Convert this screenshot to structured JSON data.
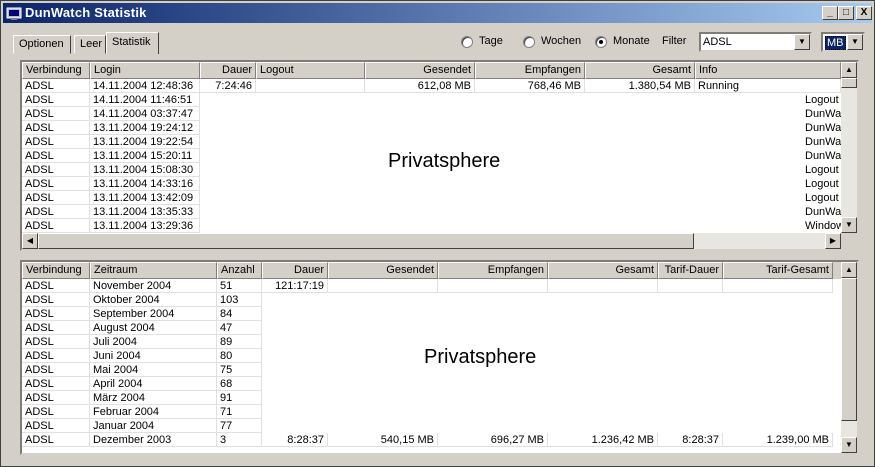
{
  "window": {
    "title": "DunWatch Statistik",
    "min": "_",
    "max": "□",
    "close": "X"
  },
  "tabs": [
    {
      "label": "Optionen"
    },
    {
      "label": "Leer"
    },
    {
      "label": "Statistik"
    }
  ],
  "radios": [
    {
      "label": "Tage",
      "checked": false
    },
    {
      "label": "Wochen",
      "checked": false
    },
    {
      "label": "Monate",
      "checked": true
    }
  ],
  "filter": {
    "label": "Filter",
    "value": "ADSL"
  },
  "unit": {
    "value": "MB"
  },
  "top_table": {
    "columns": [
      "Verbindung",
      "Login",
      "Dauer",
      "Logout",
      "Gesendet",
      "Empfangen",
      "Gesamt",
      "Info"
    ],
    "rows": [
      [
        "ADSL",
        "14.11.2004 12:48:36",
        "7:24:46",
        "",
        "612,08 MB",
        "768,46 MB",
        "1.380,54 MB",
        "Running"
      ],
      [
        "ADSL",
        "14.11.2004 11:46:51",
        "",
        "",
        "",
        "",
        "",
        "Logout"
      ],
      [
        "ADSL",
        "14.11.2004 03:37:47",
        "",
        "",
        "",
        "",
        "",
        "DunWa"
      ],
      [
        "ADSL",
        "13.11.2004 19:24:12",
        "",
        "",
        "",
        "",
        "",
        "DunWa"
      ],
      [
        "ADSL",
        "13.11.2004 19:22:54",
        "",
        "",
        "",
        "",
        "",
        "DunWa"
      ],
      [
        "ADSL",
        "13.11.2004 15:20:11",
        "",
        "",
        "",
        "",
        "",
        "DunWa"
      ],
      [
        "ADSL",
        "13.11.2004 15:08:30",
        "",
        "",
        "",
        "",
        "",
        "Logout"
      ],
      [
        "ADSL",
        "13.11.2004 14:33:16",
        "",
        "",
        "",
        "",
        "",
        "Logout"
      ],
      [
        "ADSL",
        "13.11.2004 13:42:09",
        "",
        "",
        "",
        "",
        "",
        "Logout"
      ],
      [
        "ADSL",
        "13.11.2004 13:35:33",
        "",
        "",
        "",
        "",
        "",
        "DunWa"
      ],
      [
        "ADSL",
        "13.11.2004 13:29:36",
        "",
        "",
        "",
        "",
        "",
        "Window"
      ]
    ],
    "overlay": "Privatsphere"
  },
  "bottom_table": {
    "columns": [
      "Verbindung",
      "Zeitraum",
      "Anzahl",
      "Dauer",
      "Gesendet",
      "Empfangen",
      "Gesamt",
      "Tarif-Dauer",
      "Tarif-Gesamt"
    ],
    "rows": [
      [
        "ADSL",
        "November 2004",
        "51",
        "121:17:19",
        "",
        "",
        "",
        "",
        ""
      ],
      [
        "ADSL",
        "Oktober 2004",
        "103",
        "",
        "",
        "",
        "",
        "",
        ""
      ],
      [
        "ADSL",
        "September 2004",
        "84",
        "",
        "",
        "",
        "",
        "",
        ""
      ],
      [
        "ADSL",
        "August 2004",
        "47",
        "",
        "",
        "",
        "",
        "",
        ""
      ],
      [
        "ADSL",
        "Juli 2004",
        "89",
        "",
        "",
        "",
        "",
        "",
        ""
      ],
      [
        "ADSL",
        "Juni 2004",
        "80",
        "",
        "",
        "",
        "",
        "",
        ""
      ],
      [
        "ADSL",
        "Mai 2004",
        "75",
        "",
        "",
        "",
        "",
        "",
        ""
      ],
      [
        "ADSL",
        "April 2004",
        "68",
        "",
        "",
        "",
        "",
        "",
        ""
      ],
      [
        "ADSL",
        "März 2004",
        "91",
        "",
        "",
        "",
        "",
        "",
        ""
      ],
      [
        "ADSL",
        "Februar 2004",
        "71",
        "",
        "",
        "",
        "",
        "",
        ""
      ],
      [
        "ADSL",
        "Januar 2004",
        "77",
        "",
        "",
        "",
        "",
        "",
        ""
      ],
      [
        "ADSL",
        "Dezember 2003",
        "3",
        "8:28:37",
        "540,15 MB",
        "696,27 MB",
        "1.236,42 MB",
        "8:28:37",
        "1.239,00 MB"
      ]
    ],
    "overlay": "Privatsphere"
  }
}
